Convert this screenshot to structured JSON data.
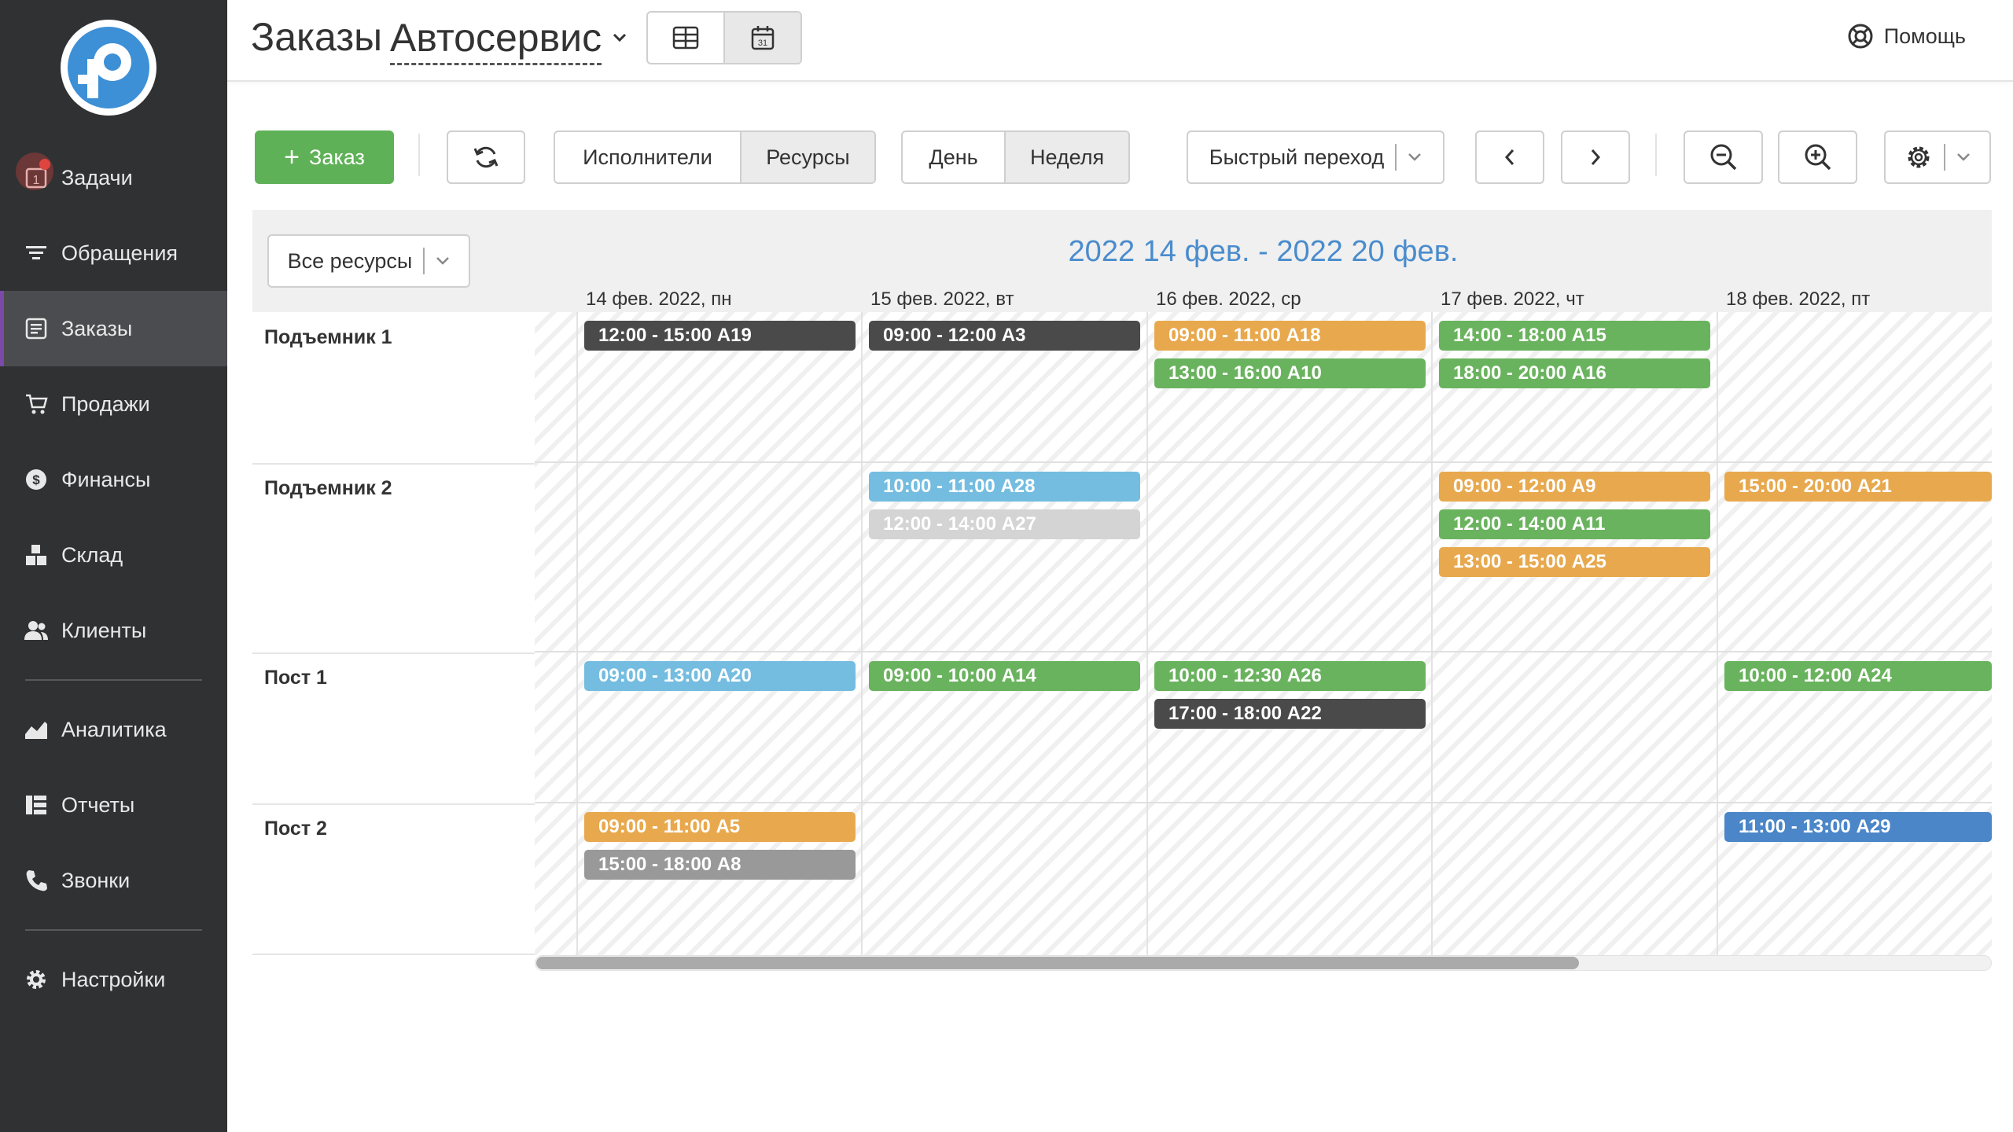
{
  "sidebar": {
    "items": [
      {
        "label": "Задачи",
        "icon": "tasks-icon",
        "badge": "1"
      },
      {
        "label": "Обращения",
        "icon": "filter-icon"
      },
      {
        "label": "Заказы",
        "icon": "orders-icon",
        "active": true
      },
      {
        "label": "Продажи",
        "icon": "cart-icon"
      },
      {
        "label": "Финансы",
        "icon": "dollar-icon"
      },
      {
        "label": "Склад",
        "icon": "warehouse-icon"
      },
      {
        "label": "Клиенты",
        "icon": "users-icon"
      },
      {
        "label": "Аналитика",
        "icon": "chart-icon"
      },
      {
        "label": "Отчеты",
        "icon": "reports-icon"
      },
      {
        "label": "Звонки",
        "icon": "phone-icon"
      },
      {
        "label": "Настройки",
        "icon": "gear-icon"
      }
    ]
  },
  "header": {
    "title": "Заказы",
    "workspace": "Автосервис",
    "help": "Помощь"
  },
  "toolbar": {
    "add_order": "Заказ",
    "performers": "Исполнители",
    "resources": "Ресурсы",
    "day": "День",
    "week": "Неделя",
    "quick_jump": "Быстрый переход"
  },
  "calendar": {
    "range": "2022 14 фев. - 2022 20 фев.",
    "resource_filter": "Все ресурсы",
    "days": [
      "14 фев. 2022, пн",
      "15 фев. 2022, вт",
      "16 фев. 2022, ср",
      "17 фев. 2022, чт",
      "18 фев. 2022, пт"
    ],
    "rows": [
      {
        "label": "Подъемник 1",
        "events": [
          {
            "day": 0,
            "slot": 0,
            "text": "12:00 - 15:00 А19",
            "color": "#4a4a4a"
          },
          {
            "day": 1,
            "slot": 0,
            "text": "09:00 - 12:00 А3",
            "color": "#4a4a4a"
          },
          {
            "day": 2,
            "slot": 0,
            "text": "09:00 - 11:00 А18",
            "color": "#e8a94e"
          },
          {
            "day": 2,
            "slot": 1,
            "text": "13:00 - 16:00 А10",
            "color": "#6ab35e"
          },
          {
            "day": 3,
            "slot": 0,
            "text": "14:00 - 18:00 А15",
            "color": "#6ab35e"
          },
          {
            "day": 3,
            "slot": 1,
            "text": "18:00 - 20:00 А16",
            "color": "#6ab35e"
          }
        ]
      },
      {
        "label": "Подъемник 2",
        "events": [
          {
            "day": 1,
            "slot": 0,
            "text": "10:00 - 11:00 А28",
            "color": "#74bde0"
          },
          {
            "day": 1,
            "slot": 1,
            "text": "12:00 - 14:00 А27",
            "color": "#d4d4d4"
          },
          {
            "day": 3,
            "slot": 0,
            "text": "09:00 - 12:00 А9",
            "color": "#e8a94e"
          },
          {
            "day": 3,
            "slot": 1,
            "text": "12:00 - 14:00 А11",
            "color": "#6ab35e"
          },
          {
            "day": 3,
            "slot": 2,
            "text": "13:00 - 15:00 А25",
            "color": "#e8a94e"
          },
          {
            "day": 4,
            "slot": 0,
            "text": "15:00 - 20:00 А21",
            "color": "#e8a94e"
          }
        ]
      },
      {
        "label": "Пост 1",
        "events": [
          {
            "day": 0,
            "slot": 0,
            "text": "09:00 - 13:00 А20",
            "color": "#74bde0"
          },
          {
            "day": 1,
            "slot": 0,
            "text": "09:00 - 10:00 А14",
            "color": "#6ab35e"
          },
          {
            "day": 2,
            "slot": 0,
            "text": "10:00 - 12:30 А26",
            "color": "#6ab35e"
          },
          {
            "day": 2,
            "slot": 1,
            "text": "17:00 - 18:00 А22",
            "color": "#4a4a4a"
          },
          {
            "day": 4,
            "slot": 0,
            "text": "10:00 - 12:00 А24",
            "color": "#6ab35e"
          }
        ]
      },
      {
        "label": "Пост 2",
        "events": [
          {
            "day": 0,
            "slot": 0,
            "text": "09:00 - 11:00 А5",
            "color": "#e8a94e"
          },
          {
            "day": 0,
            "slot": 1,
            "text": "15:00 - 18:00 А8",
            "color": "#999999"
          },
          {
            "day": 4,
            "slot": 0,
            "text": "11:00 - 13:00 А29",
            "color": "#4a86c8"
          }
        ]
      }
    ]
  }
}
